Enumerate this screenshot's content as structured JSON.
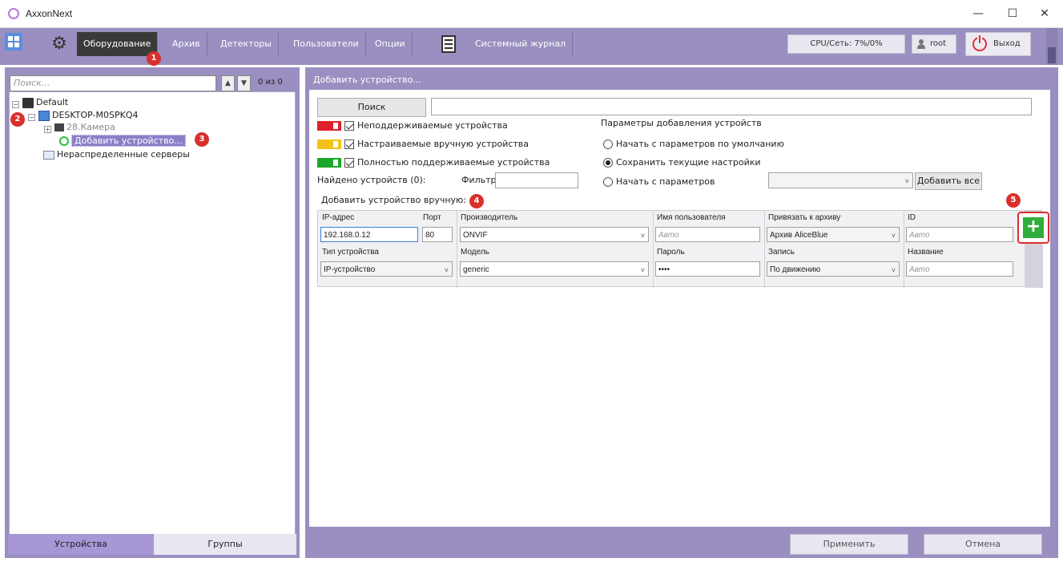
{
  "window": {
    "title": "AxxonNext",
    "minimize": "—",
    "maximize": "☐",
    "close": "✕"
  },
  "menu": {
    "items": [
      {
        "label": "Оборудование",
        "active": true
      },
      {
        "label": "Архив"
      },
      {
        "label": "Детекторы"
      },
      {
        "label": "Пользователи"
      },
      {
        "label": "Опции"
      }
    ],
    "journal": "Системный журнал",
    "cpu": "CPU/Сеть: 7%/0%",
    "user": "root",
    "exit": "Выход"
  },
  "left": {
    "search_placeholder": "Поиск...",
    "counter": "0 из 0",
    "tree": {
      "root": "Default",
      "server": "DESKTOP-M0SPKQ4",
      "camera": "28.Камера",
      "add_device": "Добавить устройство...",
      "unassigned": "Нераспределенные серверы"
    },
    "tabs": [
      "Устройства",
      "Группы"
    ]
  },
  "right": {
    "header": "Добавить устройство...",
    "search_button": "Поиск",
    "legend": {
      "unsupported": "Неподдерживаемые устройства",
      "manual": "Настраиваемые вручную устройства",
      "full": "Полностью поддерживаемые устройства"
    },
    "params_title": "Параметры добавления устройств",
    "radios": [
      {
        "label": "Начать с параметров по умолчанию",
        "checked": false
      },
      {
        "label": "Сохранить текущие настройки",
        "checked": true
      },
      {
        "label": "Начать с параметров",
        "checked": false
      }
    ],
    "found": "Найдено устройств (0):",
    "filter_label": "Фильтр:",
    "add_all": "Добавить все",
    "manual_title": "Добавить устройство вручную:",
    "form": {
      "ip_label": "IP-адрес",
      "ip_value": "192.168.0.12",
      "port_label": "Порт",
      "port_value": "80",
      "vendor_label": "Производитель",
      "vendor_value": "ONVIF",
      "username_label": "Имя пользователя",
      "username_placeholder": "Авто",
      "archive_label": "Привязать к архиву",
      "archive_value": "Архив AliceBlue",
      "id_label": "ID",
      "id_placeholder": "Авто",
      "type_label": "Тип устройства",
      "type_value": "IP-устройство",
      "model_label": "Модель",
      "model_value": "generic",
      "password_label": "Пароль",
      "password_value": "••••",
      "record_label": "Запись",
      "record_value": "По движению",
      "name_label": "Название",
      "name_placeholder": "Авто"
    },
    "apply": "Применить",
    "cancel": "Отмена"
  },
  "badges": [
    "1",
    "2",
    "3",
    "4",
    "5"
  ],
  "colors": {
    "accent": "#9a8fc0",
    "unsupported": "#e0202a",
    "manual": "#f2c218",
    "full": "#1aa82a",
    "badge": "#d9302c",
    "add_button": "#2fae3b"
  }
}
